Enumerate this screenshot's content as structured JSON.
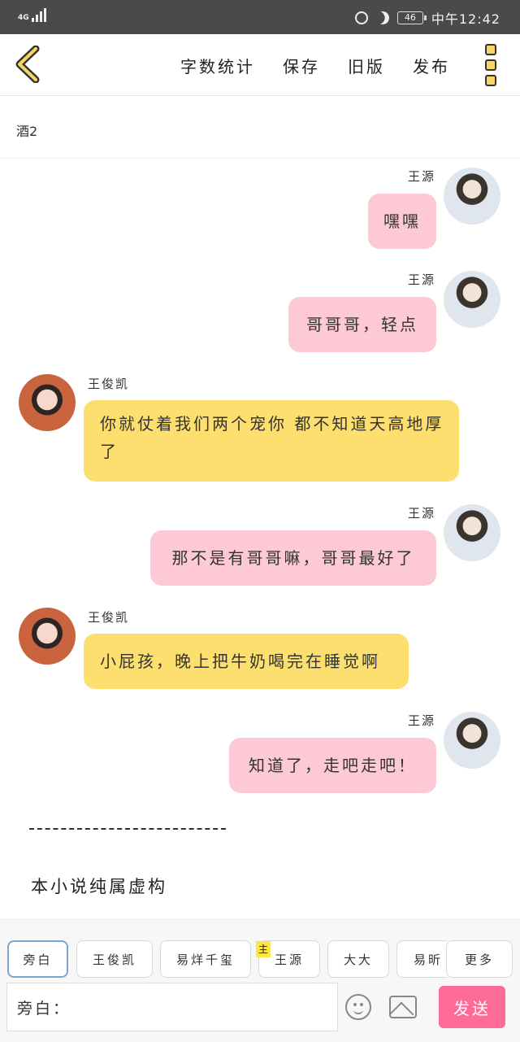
{
  "status_bar": {
    "network": "4G",
    "battery": "46",
    "time": "中午12:42"
  },
  "toolbar": {
    "word_count": "字数统计",
    "save": "保存",
    "old_version": "旧版",
    "publish": "发布"
  },
  "chapter_title": "酒2",
  "messages": [
    {
      "sender": "王源",
      "side": "right",
      "text": "嘿嘿"
    },
    {
      "sender": "王源",
      "side": "right",
      "text": "哥哥哥，轻点"
    },
    {
      "sender": "王俊凯",
      "side": "left",
      "text": "你就仗着我们两个宠你 都不知道天高地厚了"
    },
    {
      "sender": "王源",
      "side": "right",
      "text": "那不是有哥哥嘛，哥哥最好了"
    },
    {
      "sender": "王俊凯",
      "side": "left",
      "text": "小屁孩，晚上把牛奶喝完在睡觉啊"
    },
    {
      "sender": "王源",
      "side": "right",
      "text": "知道了，走吧走吧！"
    }
  ],
  "footer_note": "本小说纯属虚构",
  "characters": {
    "items": [
      {
        "label": "旁白",
        "active": true
      },
      {
        "label": "王俊凯"
      },
      {
        "label": "易烊千玺"
      },
      {
        "label": "王源",
        "main": true
      },
      {
        "label": "大大"
      },
      {
        "label": "易昕"
      }
    ],
    "main_tag": "主",
    "more": "更多"
  },
  "composer": {
    "prefix": "旁白：",
    "send": "发送"
  },
  "colors": {
    "pink_bubble": "#fcc9d5",
    "yellow_bubble": "#fddf6f",
    "send_button": "#ff6b99"
  }
}
